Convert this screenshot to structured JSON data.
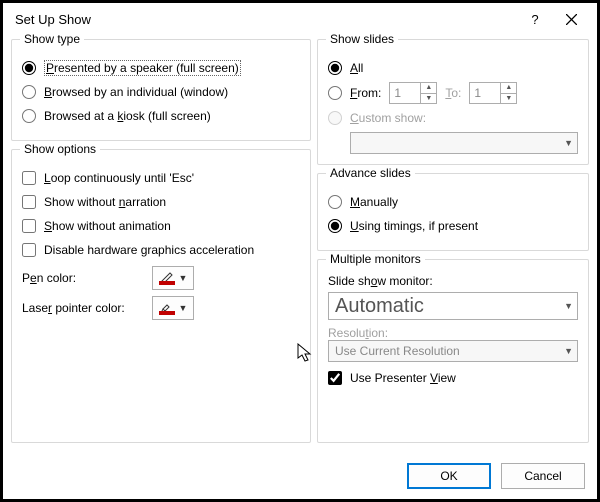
{
  "dialog": {
    "title": "Set Up Show",
    "help_label": "?",
    "ok": "OK",
    "cancel": "Cancel"
  },
  "showType": {
    "legend": "Show type",
    "opt1": "Presented by a speaker (full screen)",
    "opt2": "Browsed by an individual (window)",
    "opt3": "Browsed at a kiosk (full screen)"
  },
  "showOptions": {
    "legend": "Show options",
    "loop": "Loop continuously until 'Esc'",
    "noNarration": "Show without narration",
    "noAnimation": "Show without animation",
    "disableHW": "Disable hardware graphics acceleration",
    "penLabel": "Pen color:",
    "laserLabel": "Laser pointer color:"
  },
  "showSlides": {
    "legend": "Show slides",
    "all": "All",
    "from": "From:",
    "to": "To:",
    "fromVal": "1",
    "toVal": "1",
    "custom": "Custom show:"
  },
  "advance": {
    "legend": "Advance slides",
    "manual": "Manually",
    "timings": "Using timings, if present"
  },
  "monitors": {
    "legend": "Multiple monitors",
    "monitorLabel": "Slide show monitor:",
    "monitorValue": "Automatic",
    "resLabel": "Resolution:",
    "resValue": "Use Current Resolution",
    "presenter": "Use Presenter View"
  }
}
